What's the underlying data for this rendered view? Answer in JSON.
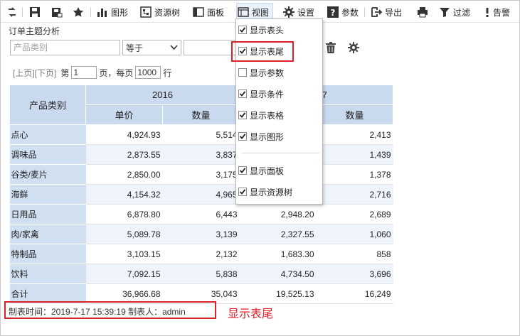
{
  "toolbar": {
    "items": [
      {
        "label": "图形"
      },
      {
        "label": "资源树"
      },
      {
        "label": "面板"
      },
      {
        "label": "视图"
      },
      {
        "label": "设置"
      },
      {
        "label": "参数"
      },
      {
        "label": "导出"
      },
      {
        "label": "过滤"
      },
      {
        "label": "告警"
      }
    ]
  },
  "report": {
    "title": "订单主题分析"
  },
  "filter": {
    "field_placeholder": "产品类别",
    "operator": "等于",
    "value": ""
  },
  "pager": {
    "prev": "[上页]",
    "next": "[下页]",
    "page_prefix": "第",
    "page_value": "1",
    "page_suffix": "页，每页",
    "rows_value": "1000",
    "rows_suffix": "行"
  },
  "table": {
    "row_header": "产品类别",
    "years": [
      "2016",
      "7"
    ],
    "measures": [
      "单价",
      "数量",
      "数量"
    ],
    "rows": [
      {
        "category": "点心",
        "v1": "4,924.93",
        "v2": "5,514",
        "v3": "",
        "v4": "2,413"
      },
      {
        "category": "调味品",
        "v1": "2,873.55",
        "v2": "3,837",
        "v3": "",
        "v4": "1,439"
      },
      {
        "category": "谷类/麦片",
        "v1": "2,850.00",
        "v2": "3,175",
        "v3": "",
        "v4": "1,378"
      },
      {
        "category": "海鲜",
        "v1": "4,154.32",
        "v2": "4,965",
        "v3": "",
        "v4": "2,716"
      },
      {
        "category": "日用品",
        "v1": "6,878.80",
        "v2": "6,443",
        "v3": "2,948.20",
        "v4": "2,689"
      },
      {
        "category": "肉/家禽",
        "v1": "5,089.78",
        "v2": "3,139",
        "v3": "2,327.55",
        "v4": "1,060"
      },
      {
        "category": "特制品",
        "v1": "3,103.15",
        "v2": "2,132",
        "v3": "1,683.30",
        "v4": "858"
      },
      {
        "category": "饮料",
        "v1": "7,092.15",
        "v2": "5,838",
        "v3": "4,734.50",
        "v4": "3,696"
      },
      {
        "category": "合计",
        "v1": "36,966.68",
        "v2": "35,043",
        "v3": "19,525.13",
        "v4": "16,249"
      }
    ]
  },
  "footer": {
    "text": "制表时间：2019-7-17 15:39:19   制表人：admin"
  },
  "annotation": "显示表尾",
  "view_menu": {
    "items": [
      {
        "label": "显示表头",
        "checked": true
      },
      {
        "label": "显示表尾",
        "checked": true
      },
      {
        "label": "显示参数",
        "checked": false
      },
      {
        "label": "显示条件",
        "checked": true
      },
      {
        "label": "显示表格",
        "checked": true
      },
      {
        "label": "显示图形",
        "checked": true
      },
      {
        "label": "显示面板",
        "checked": true
      },
      {
        "label": "显示资源树",
        "checked": true
      }
    ]
  },
  "colors": {
    "accent_red": "#d9232a",
    "header_blue": "#c9d9ee",
    "stripe_blue": "#eef3fc"
  },
  "icons": [
    "refresh-icon",
    "save-icon",
    "save-as-icon",
    "favorite-icon",
    "chart-icon",
    "resource-tree-icon",
    "panel-icon",
    "view-icon",
    "gear-icon",
    "help-icon",
    "export-icon",
    "print-icon",
    "filter-icon",
    "alert-icon",
    "delete-icon",
    "settings-icon"
  ]
}
